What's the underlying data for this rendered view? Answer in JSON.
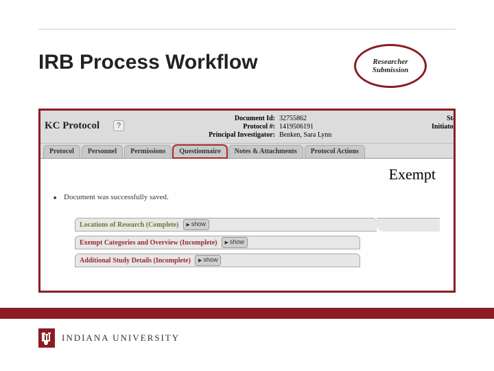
{
  "slide": {
    "title": "IRB Process Workflow",
    "badge_text": "Researcher Submission",
    "exempt_label": "Exempt"
  },
  "kc": {
    "heading": "KC Protocol",
    "help_icon": "?",
    "labels": {
      "doc_id": "Document Id:",
      "protocol": "Protocol #:",
      "pi": "Principal Investigator:",
      "sta": "Sta",
      "initiator": "Initiator:La"
    },
    "values": {
      "doc_id": "32755862",
      "protocol": "1419506191",
      "pi": "Benken, Sara Lynn"
    },
    "tabs": [
      "Protocol",
      "Personnel",
      "Permissions",
      "Questionnaire",
      "Notes & Attachments",
      "Protocol Actions"
    ],
    "highlighted_tab_index": 3,
    "status_message": "Document was successfully saved.",
    "sections": [
      {
        "label": "Locations of Research (Complete)",
        "btn": "show"
      },
      {
        "label": "Exempt Categories and Overview (Incomplete)",
        "btn": "show"
      },
      {
        "label": "Additional Study Details (Incomplete)",
        "btn": "show"
      }
    ]
  },
  "footer": {
    "org": "INDIANA UNIVERSITY",
    "logo_letters": "IU"
  },
  "colors": {
    "iu_crimson": "#8a1c22"
  }
}
